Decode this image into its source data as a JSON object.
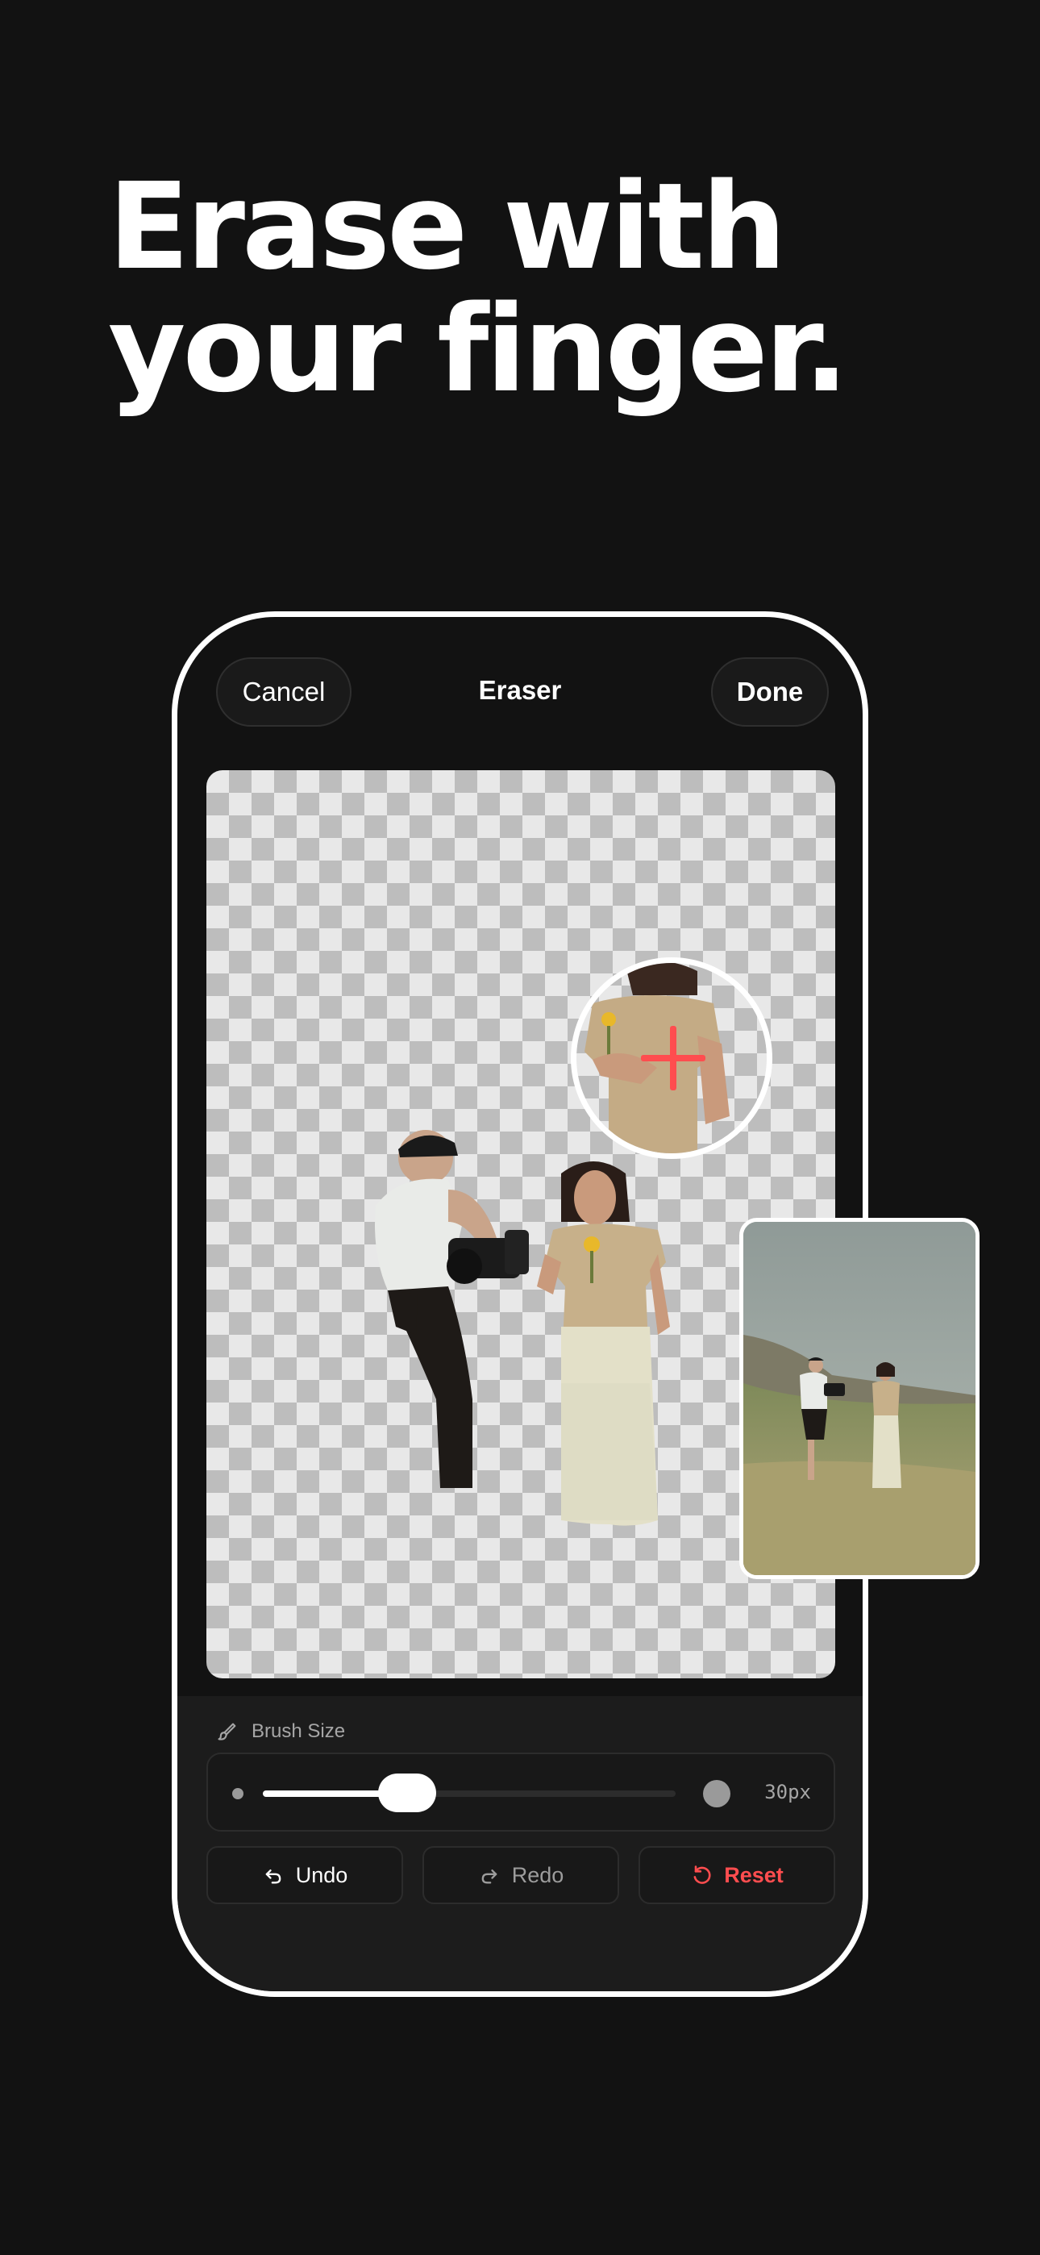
{
  "headline": {
    "line1": "Erase with",
    "line2": "your finger."
  },
  "nav": {
    "cancel_label": "Cancel",
    "title": "Eraser",
    "done_label": "Done"
  },
  "brush": {
    "label": "Brush Size",
    "value_text": "30px",
    "slider_fraction": 0.35
  },
  "actions": {
    "undo_label": "Undo",
    "redo_label": "Redo",
    "reset_label": "Reset"
  },
  "colors": {
    "background": "#121212",
    "accent_reset": "#ff4d4f",
    "crosshair": "#ff4d4f"
  },
  "icons": {
    "brush": "paintbrush-icon",
    "undo": "undo-arrow-icon",
    "redo": "redo-arrow-icon",
    "reset": "rotate-ccw-icon"
  }
}
